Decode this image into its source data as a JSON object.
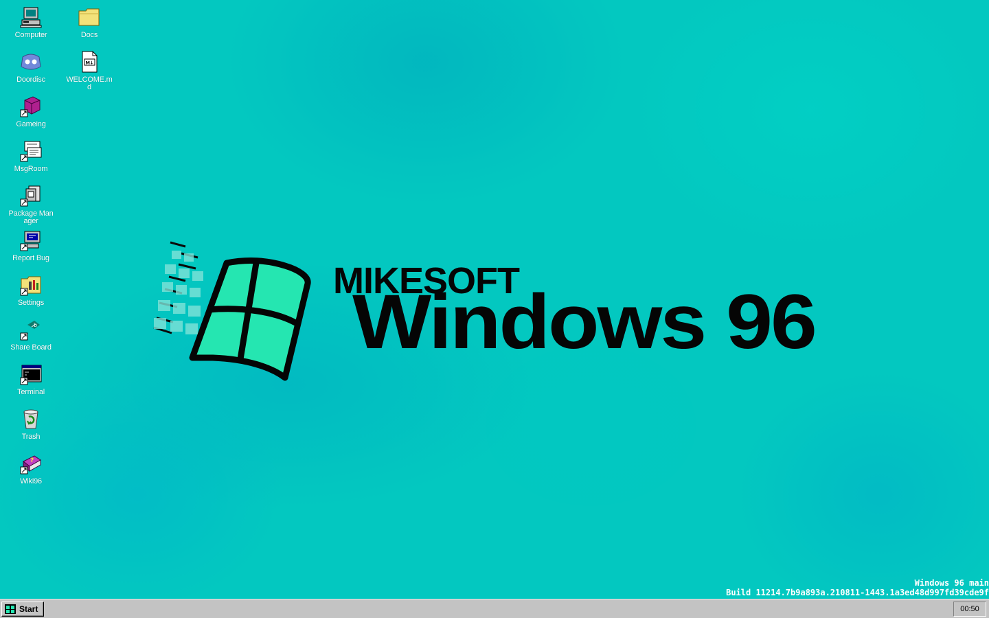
{
  "desktop": {
    "icons": [
      {
        "label": "Computer",
        "icon": "computer-icon"
      },
      {
        "label": "Docs",
        "icon": "folder-icon"
      },
      {
        "label": "Doordisc",
        "icon": "doordisc-icon"
      },
      {
        "label": "WELCOME.md",
        "icon": "markdown-file-icon"
      },
      {
        "label": "Gameing",
        "icon": "game-cube-icon"
      },
      {
        "label": "MsgRoom",
        "icon": "msgroom-icon"
      },
      {
        "label": "Package Manager",
        "icon": "package-manager-icon"
      },
      {
        "label": "Report Bug",
        "icon": "report-bug-icon"
      },
      {
        "label": "Settings",
        "icon": "settings-folder-icon"
      },
      {
        "label": "Share Board",
        "icon": "share-board-icon"
      },
      {
        "label": "Terminal",
        "icon": "terminal-icon"
      },
      {
        "label": "Trash",
        "icon": "trash-icon"
      },
      {
        "label": "Wiki96",
        "icon": "wiki-book-icon"
      }
    ]
  },
  "wallpaper": {
    "brand_top": "MIKESOFT",
    "brand_main": "Windows 96",
    "colors": {
      "background": "#03c8c0",
      "logo_fill": "#22e8b0",
      "text": "#050505"
    }
  },
  "build_info": {
    "line1": "Windows 96 main",
    "line2": "Build 11214.7b9a893a.210811-1443.1a3ed48d997fd39cde9f"
  },
  "taskbar": {
    "start_label": "Start",
    "clock": "00:50"
  }
}
